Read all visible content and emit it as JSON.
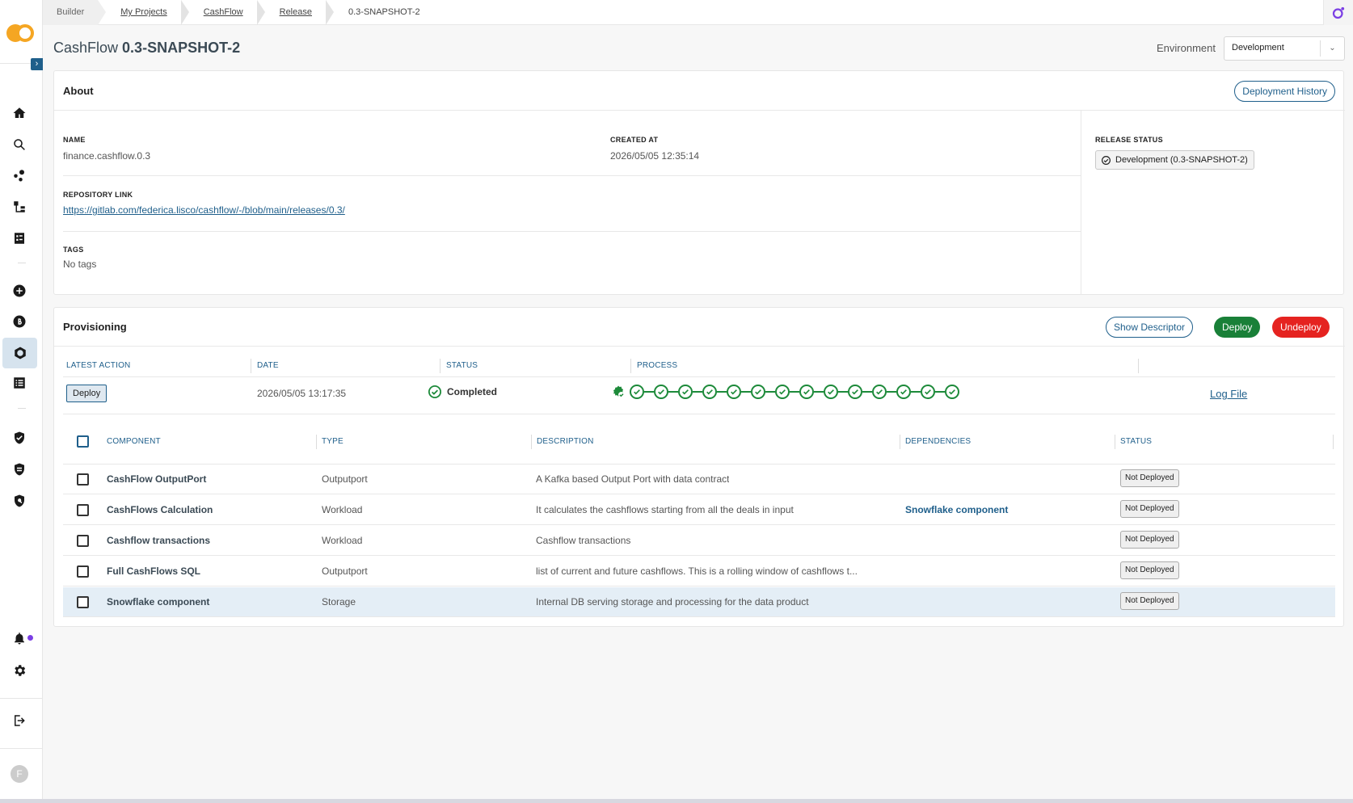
{
  "breadcrumb": [
    "Builder",
    "My Projects",
    "CashFlow",
    "Release",
    "0.3-SNAPSHOT-2"
  ],
  "page": {
    "title_prefix": "CashFlow",
    "title_version": "0.3-SNAPSHOT-2"
  },
  "environment": {
    "label": "Environment",
    "value": "Development"
  },
  "about": {
    "title": "About",
    "history_button": "Deployment History",
    "name_label": "NAME",
    "name_value": "finance.cashflow.0.3",
    "created_label": "CREATED AT",
    "created_value": "2026/05/05 12:35:14",
    "repo_label": "REPOSITORY LINK",
    "repo_value": "https://gitlab.com/federica.lisco/cashflow/-/blob/main/releases/0.3/",
    "tags_label": "TAGS",
    "tags_value": "No tags",
    "release_status_label": "RELEASE STATUS",
    "release_status_value": "Development (0.3-SNAPSHOT-2)"
  },
  "provisioning": {
    "title": "Provisioning",
    "show_descriptor": "Show Descriptor",
    "deploy": "Deploy",
    "undeploy": "Undeploy",
    "headers": [
      "LATEST ACTION",
      "DATE",
      "STATUS",
      "PROCESS"
    ],
    "latest_action": "Deploy",
    "date": "2026/05/05 13:17:35",
    "status": "Completed",
    "process_steps": 14,
    "log_file": "Log File"
  },
  "components": {
    "headers": [
      "COMPONENT",
      "TYPE",
      "DESCRIPTION",
      "DEPENDENCIES",
      "STATUS"
    ],
    "rows": [
      {
        "name": "CashFlow OutputPort",
        "type": "Outputport",
        "description": "A Kafka based Output Port with data contract",
        "dependency": "",
        "status": "Not Deployed"
      },
      {
        "name": "CashFlows Calculation",
        "type": "Workload",
        "description": "It calculates the cashflows starting from all the deals in input",
        "dependency": "Snowflake component",
        "status": "Not Deployed"
      },
      {
        "name": "Cashflow transactions",
        "type": "Workload",
        "description": "Cashflow transactions",
        "dependency": "",
        "status": "Not Deployed"
      },
      {
        "name": "Full CashFlows SQL",
        "type": "Outputport",
        "description": "list of current and future cashflows. This is a rolling window of cashflows t...",
        "dependency": "",
        "status": "Not Deployed"
      },
      {
        "name": "Snowflake component",
        "type": "Storage",
        "description": "Internal DB serving storage and processing for the data product",
        "dependency": "",
        "status": "Not Deployed"
      }
    ]
  },
  "user": {
    "initial": "F"
  },
  "colors": {
    "primary": "#1f5f8b",
    "success": "#198038",
    "danger": "#e52320",
    "accent": "#7b3fe4"
  }
}
